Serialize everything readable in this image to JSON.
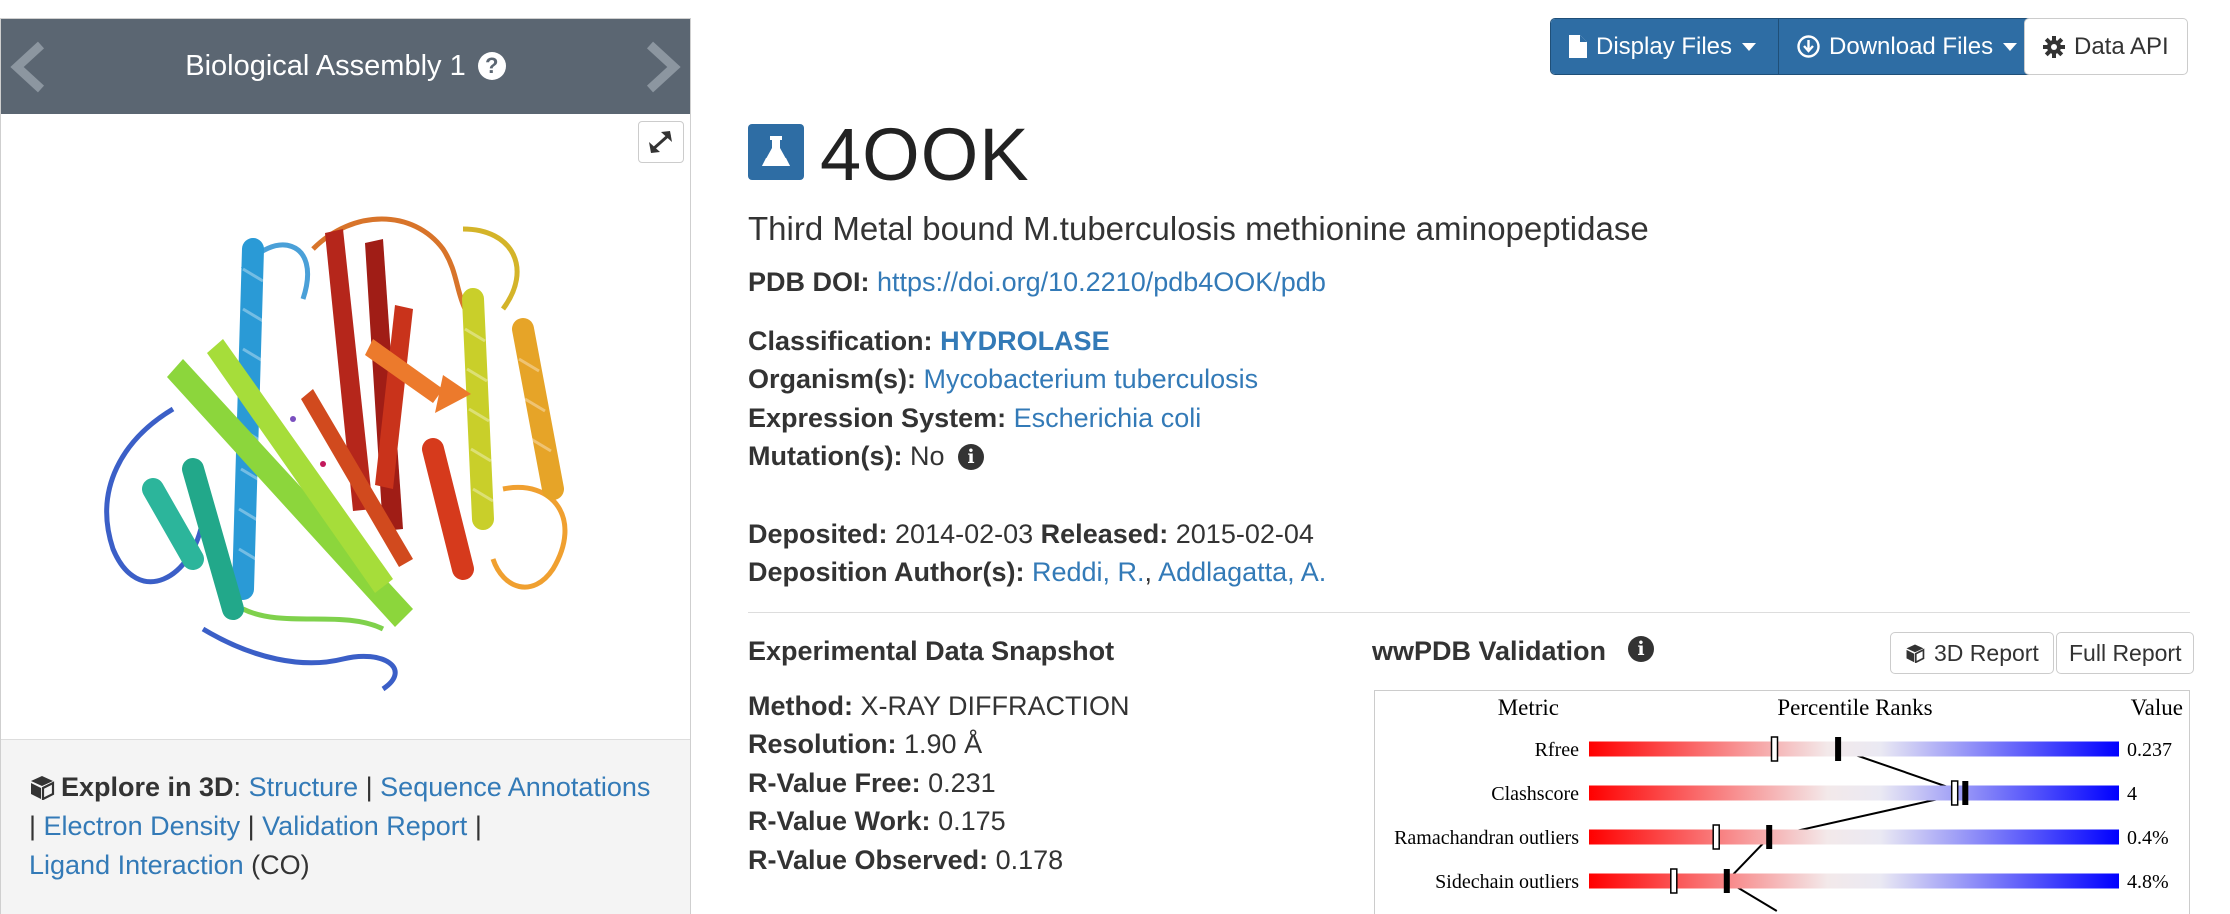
{
  "viewer": {
    "title": "Biological Assembly 1",
    "help_icon": "question-circle-icon",
    "prev_icon": "chevron-left-icon",
    "next_icon": "chevron-right-icon",
    "expand_icon": "expand-icon"
  },
  "explore": {
    "icon": "cube-icon",
    "label": "Explore in 3D",
    "colon": ":",
    "links": {
      "structure": "Structure",
      "sequence": "Sequence Annotations",
      "density": "Electron Density",
      "validation": "Validation Report",
      "ligand": "Ligand Interaction"
    },
    "ligand_suffix": "(CO)",
    "sep": "|"
  },
  "toolbar": {
    "display_files": "Display Files",
    "download_files": "Download Files",
    "data_api": "Data API"
  },
  "entry": {
    "id": "4OOK",
    "icon": "flask-icon",
    "title": "Third Metal bound M.tuberculosis methionine aminopeptidase",
    "doi_label": "PDB DOI:",
    "doi": "https://doi.org/10.2210/pdb4OOK/pdb",
    "classification_label": "Classification:",
    "classification": "HYDROLASE",
    "organism_label": "Organism(s):",
    "organism": "Mycobacterium tuberculosis",
    "expression_label": "Expression System:",
    "expression": "Escherichia coli",
    "mutation_label": "Mutation(s):",
    "mutation": "No",
    "deposited_label": "Deposited:",
    "deposited": "2014-02-03",
    "released_label": "Released:",
    "released": "2015-02-04",
    "authors_label": "Deposition Author(s):",
    "authors": [
      "Reddi, R.",
      "Addlagatta, A."
    ],
    "author_sep": ","
  },
  "experimental": {
    "title": "Experimental Data Snapshot",
    "rows": [
      {
        "label": "Method:",
        "value": "X-RAY DIFFRACTION"
      },
      {
        "label": "Resolution:",
        "value": "1.90 Å"
      },
      {
        "label": "R-Value Free:",
        "value": "0.231"
      },
      {
        "label": "R-Value Work:",
        "value": "0.175"
      },
      {
        "label": "R-Value Observed:",
        "value": "0.178"
      }
    ]
  },
  "validation": {
    "title": "wwPDB Validation",
    "report_3d": "3D Report",
    "full_report": "Full Report",
    "headers": {
      "metric": "Metric",
      "percentile": "Percentile Ranks",
      "value": "Value"
    },
    "metrics": [
      {
        "name": "Rfree",
        "value": "0.237",
        "percentile_all": 0.35,
        "percentile_res": 0.47
      },
      {
        "name": "Clashscore",
        "value": "4",
        "percentile_all": 0.69,
        "percentile_res": 0.71
      },
      {
        "name": "Ramachandran outliers",
        "value": "0.4%",
        "percentile_all": 0.24,
        "percentile_res": 0.34
      },
      {
        "name": "Sidechain outliers",
        "value": "4.8%",
        "percentile_all": 0.16,
        "percentile_res": 0.26
      }
    ]
  },
  "colors": {
    "header_bg": "#5b6672",
    "link": "#337ab7",
    "button_primary": "#2e6da4",
    "bar_low": "#ff0000",
    "bar_high": "#0000ff"
  }
}
